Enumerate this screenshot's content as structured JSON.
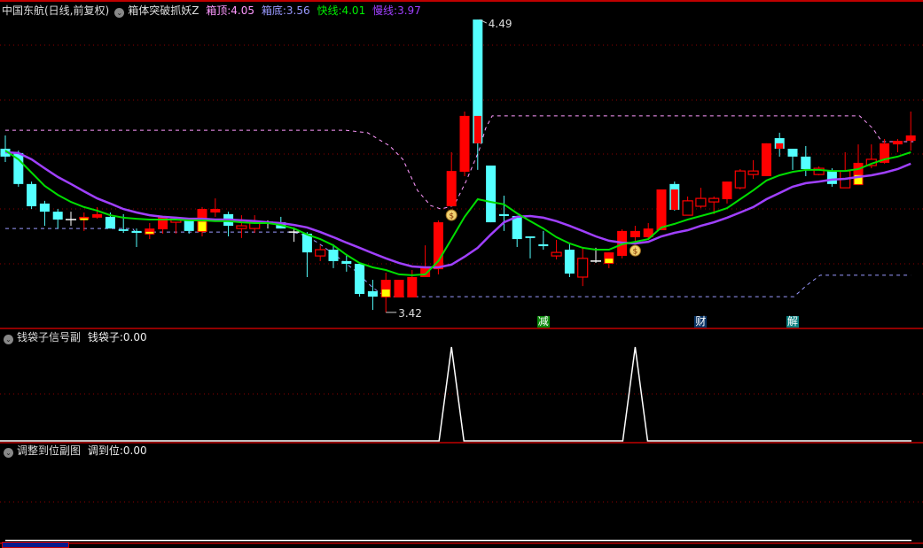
{
  "header": {
    "stock": "中国东航(日线,前复权)",
    "indicator": "箱体突破抓妖Z",
    "box_top_label": "箱顶:",
    "box_top_value": "4.05",
    "box_bottom_label": "箱底:",
    "box_bottom_value": "3.56",
    "fast_label": "快线:",
    "fast_value": "4.01",
    "slow_label": "慢线:",
    "slow_value": "3.97"
  },
  "sub1": {
    "title": "钱袋子信号副",
    "label": "钱袋子:",
    "value": "0.00"
  },
  "sub2": {
    "title": "调整到位副图",
    "label": "调到位:",
    "value": "0.00"
  },
  "markers": [
    {
      "text": "减",
      "index": 41,
      "color": "#0a8a0a"
    },
    {
      "text": "财",
      "index": 53,
      "color": "#0a3566"
    },
    {
      "text": "解",
      "index": 60,
      "color": "#0a8080"
    }
  ],
  "annotations": {
    "high": "4.49",
    "high_index": 36,
    "low": "3.42",
    "low_index": 29
  },
  "colors": {
    "up": "#ff0000",
    "down": "#54ffff",
    "fast": "#00dd00",
    "slow": "#a040ff",
    "box_top": "#ff99ff",
    "box_bottom": "#9999ff",
    "grid": "#8b0000",
    "separator": "#c00000"
  },
  "chart_data": {
    "type": "candlestick",
    "price_range": [
      3.39,
      4.57
    ],
    "candles_ohlc": [
      [
        4.02,
        4.069,
        3.971,
        3.991
      ],
      [
        4.004,
        4.013,
        3.88,
        3.89
      ],
      [
        3.89,
        3.899,
        3.798,
        3.808
      ],
      [
        3.818,
        3.828,
        3.736,
        3.788
      ],
      [
        3.788,
        3.798,
        3.726,
        3.759
      ],
      [
        3.759,
        3.788,
        3.736,
        3.759
      ],
      [
        3.759,
        3.785,
        3.717,
        3.769
      ],
      [
        3.766,
        3.805,
        3.762,
        3.779
      ],
      [
        3.769,
        3.785,
        3.726,
        3.726
      ],
      [
        3.723,
        3.779,
        3.71,
        3.717
      ],
      [
        3.717,
        3.726,
        3.658,
        3.71
      ],
      [
        3.704,
        3.746,
        3.687,
        3.726
      ],
      [
        3.723,
        3.769,
        3.707,
        3.769
      ],
      [
        3.749,
        3.769,
        3.707,
        3.765
      ],
      [
        3.759,
        3.759,
        3.707,
        3.717
      ],
      [
        3.713,
        3.805,
        3.697,
        3.798
      ],
      [
        3.785,
        3.837,
        3.769,
        3.798
      ],
      [
        3.779,
        3.788,
        3.697,
        3.736
      ],
      [
        3.726,
        3.775,
        3.691,
        3.736
      ],
      [
        3.726,
        3.775,
        3.71,
        3.749
      ],
      [
        3.749,
        3.756,
        3.726,
        3.749
      ],
      [
        3.749,
        3.769,
        3.726,
        3.726
      ],
      [
        3.713,
        3.73,
        3.677,
        3.713
      ],
      [
        3.707,
        3.713,
        3.547,
        3.638
      ],
      [
        3.625,
        3.664,
        3.606,
        3.648
      ],
      [
        3.648,
        3.668,
        3.58,
        3.606
      ],
      [
        3.606,
        3.629,
        3.567,
        3.596
      ],
      [
        3.596,
        3.596,
        3.475,
        3.485
      ],
      [
        3.495,
        3.537,
        3.426,
        3.475
      ],
      [
        3.472,
        3.563,
        3.417,
        3.537
      ],
      [
        3.472,
        3.537,
        3.472,
        3.537
      ],
      [
        3.472,
        3.573,
        3.472,
        3.547
      ],
      [
        3.547,
        3.664,
        3.547,
        3.583
      ],
      [
        3.576,
        3.756,
        3.557,
        3.749
      ],
      [
        3.808,
        4.007,
        3.808,
        3.938
      ],
      [
        3.935,
        4.157,
        3.919,
        4.141
      ],
      [
        4.496,
        4.496,
        3.942,
        4.04
      ],
      [
        3.958,
        3.958,
        3.749,
        3.749
      ],
      [
        3.779,
        3.847,
        3.717,
        3.772
      ],
      [
        3.772,
        3.772,
        3.658,
        3.687
      ],
      [
        3.697,
        3.697,
        3.616,
        3.691
      ],
      [
        3.668,
        3.717,
        3.648,
        3.661
      ],
      [
        3.625,
        3.684,
        3.612,
        3.638
      ],
      [
        3.648,
        3.668,
        3.547,
        3.56
      ],
      [
        3.547,
        3.655,
        3.514,
        3.616
      ],
      [
        3.606,
        3.655,
        3.599,
        3.606
      ],
      [
        3.596,
        3.638,
        3.58,
        3.638
      ],
      [
        3.625,
        3.723,
        3.616,
        3.717
      ],
      [
        3.694,
        3.736,
        3.677,
        3.717
      ],
      [
        3.694,
        3.746,
        3.684,
        3.726
      ],
      [
        3.72,
        3.87,
        3.72,
        3.87
      ],
      [
        3.89,
        3.899,
        3.792,
        3.795
      ],
      [
        3.775,
        3.844,
        3.775,
        3.828
      ],
      [
        3.808,
        3.876,
        3.801,
        3.837
      ],
      [
        3.824,
        3.844,
        3.779,
        3.837
      ],
      [
        3.834,
        3.899,
        3.818,
        3.899
      ],
      [
        3.876,
        3.945,
        3.87,
        3.938
      ],
      [
        3.925,
        3.978,
        3.909,
        3.938
      ],
      [
        3.919,
        4.04,
        3.919,
        4.04
      ],
      [
        4.059,
        4.079,
        3.991,
        4.02
      ],
      [
        4.02,
        4.02,
        3.942,
        3.991
      ],
      [
        3.991,
        4.03,
        3.919,
        3.945
      ],
      [
        3.925,
        3.955,
        3.922,
        3.948
      ],
      [
        3.938,
        3.948,
        3.88,
        3.89
      ],
      [
        3.876,
        4.007,
        3.876,
        3.938
      ],
      [
        3.886,
        4.036,
        3.886,
        3.968
      ],
      [
        3.958,
        4.036,
        3.948,
        3.981
      ],
      [
        3.968,
        4.056,
        3.965,
        4.04
      ],
      [
        4.036,
        4.056,
        4.007,
        4.049
      ],
      [
        4.049,
        4.157,
        4.013,
        4.069
      ]
    ],
    "hollow_up": [
      13,
      18,
      19,
      24,
      42,
      44,
      52,
      53,
      54,
      56,
      57,
      62,
      64,
      66
    ],
    "yellow_part": [
      6,
      11,
      15,
      29,
      46,
      65
    ],
    "inner_red": {
      "36": [
        4.141,
        4.04
      ],
      "51": [
        3.87,
        3.795
      ],
      "59": [
        4.04,
        4.02
      ]
    },
    "fast_line": [
      4.013,
      3.981,
      3.932,
      3.883,
      3.85,
      3.824,
      3.805,
      3.792,
      3.775,
      3.766,
      3.762,
      3.759,
      3.759,
      3.759,
      3.756,
      3.756,
      3.753,
      3.753,
      3.749,
      3.746,
      3.746,
      3.739,
      3.726,
      3.704,
      3.687,
      3.664,
      3.629,
      3.599,
      3.583,
      3.573,
      3.557,
      3.554,
      3.557,
      3.606,
      3.687,
      3.769,
      3.834,
      3.824,
      3.815,
      3.782,
      3.753,
      3.726,
      3.694,
      3.671,
      3.655,
      3.648,
      3.648,
      3.668,
      3.677,
      3.687,
      3.73,
      3.743,
      3.759,
      3.772,
      3.785,
      3.801,
      3.834,
      3.867,
      3.903,
      3.922,
      3.935,
      3.942,
      3.942,
      3.938,
      3.938,
      3.945,
      3.965,
      3.981,
      3.991,
      4.007
    ],
    "slow_line": [
      4.007,
      4.004,
      3.981,
      3.948,
      3.916,
      3.89,
      3.863,
      3.837,
      3.818,
      3.798,
      3.785,
      3.775,
      3.769,
      3.766,
      3.762,
      3.762,
      3.759,
      3.759,
      3.756,
      3.753,
      3.749,
      3.746,
      3.739,
      3.73,
      3.713,
      3.694,
      3.674,
      3.655,
      3.635,
      3.616,
      3.599,
      3.586,
      3.583,
      3.583,
      3.593,
      3.622,
      3.655,
      3.704,
      3.749,
      3.769,
      3.772,
      3.766,
      3.753,
      3.736,
      3.717,
      3.697,
      3.681,
      3.674,
      3.671,
      3.677,
      3.697,
      3.71,
      3.72,
      3.736,
      3.749,
      3.766,
      3.785,
      3.805,
      3.834,
      3.857,
      3.88,
      3.893,
      3.899,
      3.906,
      3.909,
      3.916,
      3.922,
      3.932,
      3.945,
      3.965
    ],
    "box_top": [
      [
        0,
        4.088
      ],
      [
        25.9,
        4.088
      ],
      [
        27.6,
        4.079
      ],
      [
        29.3,
        4.03
      ],
      [
        30.3,
        3.981
      ],
      [
        31.4,
        3.867
      ],
      [
        32.4,
        3.811
      ],
      [
        33.2,
        3.798
      ],
      [
        34.2,
        3.811
      ],
      [
        35.1,
        3.899
      ],
      [
        36.1,
        4.013
      ],
      [
        36.6,
        4.095
      ],
      [
        37.1,
        4.141
      ],
      [
        65.1,
        4.141
      ],
      [
        66.1,
        4.095
      ],
      [
        66.8,
        4.046
      ],
      [
        69.2,
        4.046
      ]
    ],
    "box_bottom": [
      [
        0,
        3.726
      ],
      [
        9.7,
        3.726
      ],
      [
        9.9,
        3.713
      ],
      [
        21.9,
        3.713
      ],
      [
        22.9,
        3.7
      ],
      [
        23.9,
        3.671
      ],
      [
        25.3,
        3.622
      ],
      [
        26.6,
        3.573
      ],
      [
        28,
        3.508
      ],
      [
        29,
        3.475
      ],
      [
        60.1,
        3.475
      ],
      [
        61.1,
        3.518
      ],
      [
        62.1,
        3.554
      ],
      [
        69,
        3.554
      ]
    ],
    "money_bag_indices": [
      34,
      48
    ],
    "signal_peaks": [
      34,
      48
    ]
  }
}
